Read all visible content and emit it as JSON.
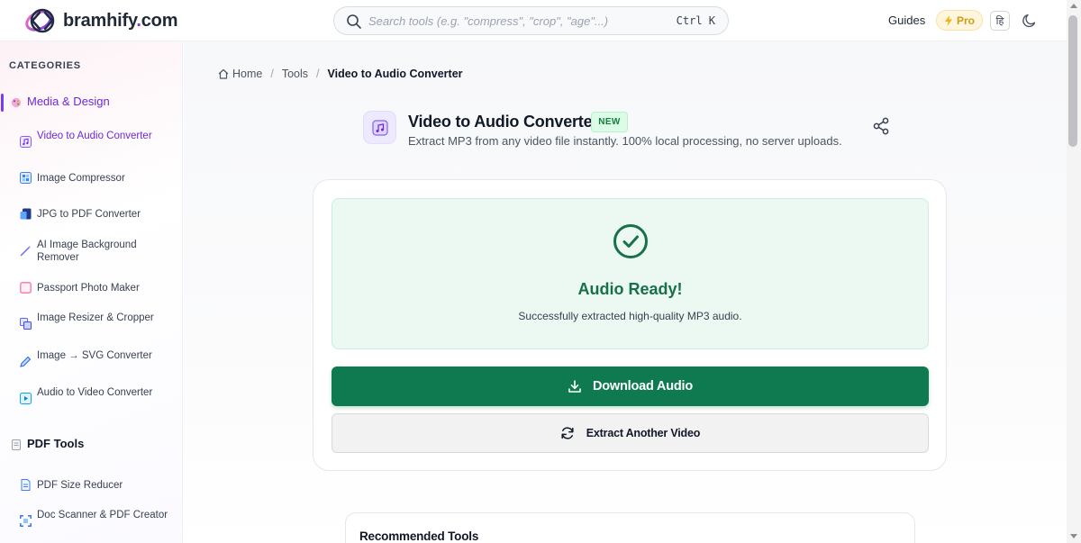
{
  "header": {
    "logo": {
      "name": "bramhify",
      "dot": ".",
      "tld": "com",
      "icon": "bramhify-logo-icon"
    },
    "search": {
      "placeholder": "Search tools (e.g. \"compress\", \"crop\", \"age\"...)",
      "value": "",
      "shortcut": "Ctrl K",
      "icon": "search-icon"
    },
    "guides_label": "Guides",
    "pro_label": "Pro",
    "pro_icon": "lightning-icon",
    "language_label": "हि",
    "theme_icon": "moon-icon"
  },
  "sidebar": {
    "categories_title": "CATEGORIES",
    "groups": [
      {
        "label": "Media & Design",
        "icon": "palette-icon",
        "active": true,
        "items": [
          {
            "label": "Video to Audio Converter",
            "icon": "music-note-icon",
            "active": true
          },
          {
            "label": "Image Compressor",
            "icon": "image-grid-icon"
          },
          {
            "label": "JPG to PDF Converter",
            "icon": "document-image-icon"
          },
          {
            "label": "AI Image Background Remover",
            "icon": "magic-wand-icon"
          },
          {
            "label": "Passport Photo Maker",
            "icon": "photo-frame-icon"
          },
          {
            "label": "Image Resizer & Cropper",
            "icon": "resize-icon"
          },
          {
            "label": "Image → SVG Converter",
            "icon": "pen-icon"
          },
          {
            "label": "Audio to Video Converter",
            "icon": "video-icon"
          }
        ]
      },
      {
        "label": "PDF Tools",
        "icon": "page-icon",
        "active": false,
        "items": [
          {
            "label": "PDF Size Reducer",
            "icon": "pdf-file-icon"
          },
          {
            "label": "Doc Scanner & PDF Creator",
            "icon": "scan-icon"
          }
        ]
      }
    ]
  },
  "breadcrumb": {
    "home": "Home",
    "separator": "/",
    "tools": "Tools",
    "current": "Video to Audio Converter",
    "home_icon": "home-icon"
  },
  "tool": {
    "title": "Video to Audio Converter",
    "badge": "NEW",
    "subtitle": "Extract MP3 from any video file instantly. 100% local processing, no server uploads.",
    "icon": "music-note-icon",
    "share_icon": "share-icon"
  },
  "result": {
    "title": "Audio Ready!",
    "message": "Successfully extracted high-quality MP3 audio.",
    "check_icon": "check-circle-icon",
    "download_label": "Download Audio",
    "download_icon": "download-icon",
    "extract_another_label": "Extract Another Video",
    "extract_another_icon": "refresh-icon"
  },
  "recommended": {
    "title": "Recommended Tools"
  },
  "colors": {
    "brand_purple": "#7c3aed",
    "success_green": "#0f7a50",
    "success_bg": "#ecf8f2",
    "pro_amber": "#d39b12"
  }
}
